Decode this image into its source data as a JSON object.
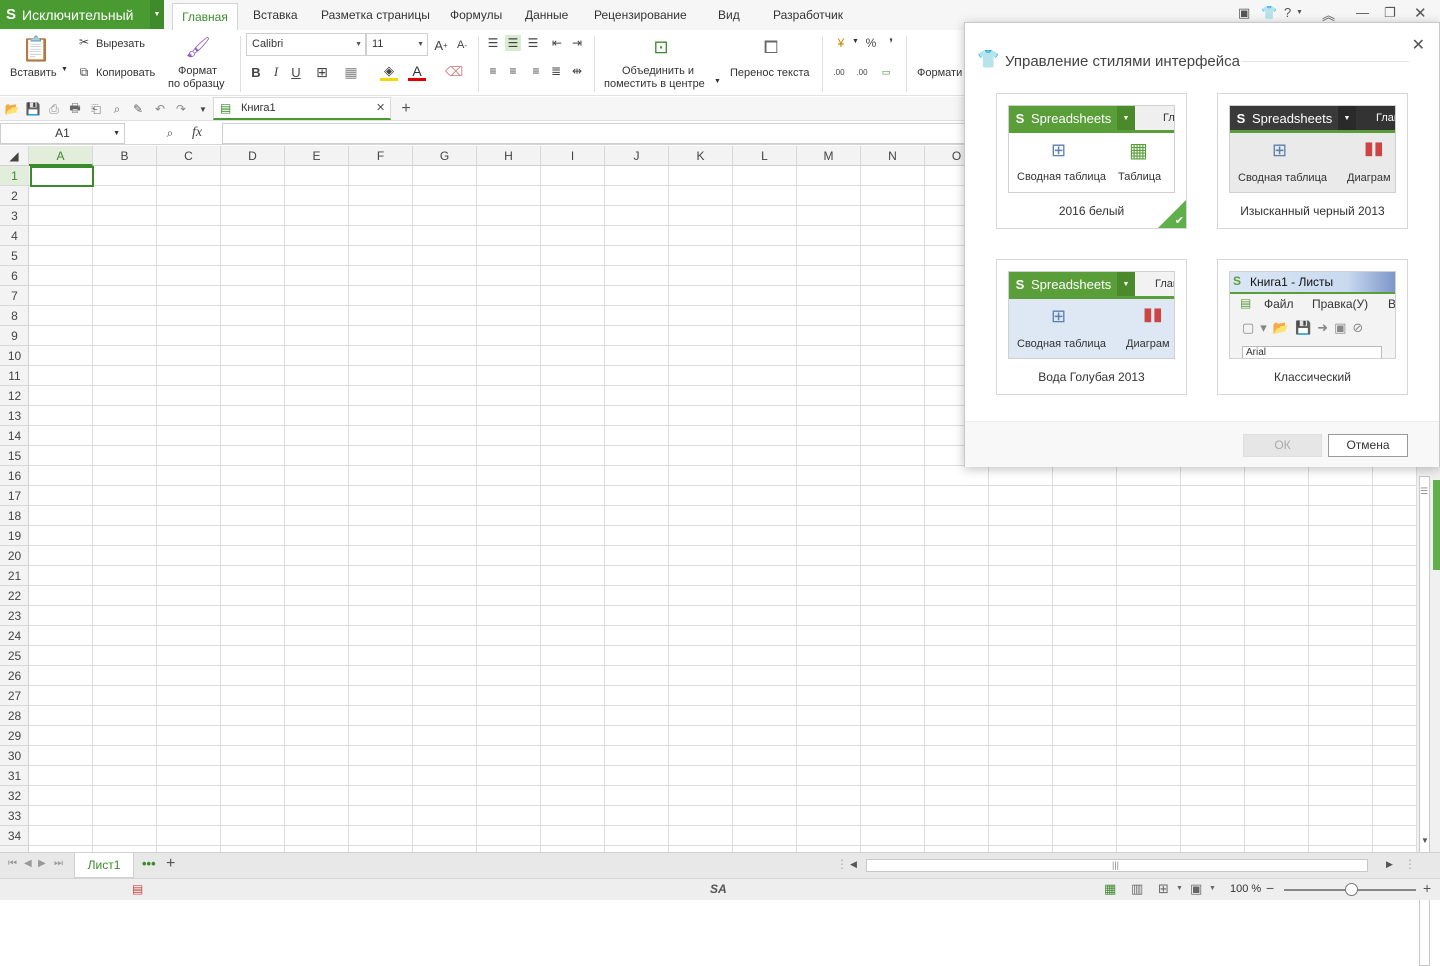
{
  "app": {
    "name": "Исключительный",
    "logo_glyph": "S",
    "accent_color": "#4a9a32"
  },
  "menu_tabs": [
    "Главная",
    "Вставка",
    "Разметка страницы",
    "Формулы",
    "Данные",
    "Рецензирование",
    "Вид",
    "Разработчик"
  ],
  "ribbon": {
    "paste_label": "Вставить",
    "cut_label": "Вырезать",
    "copy_label": "Копировать",
    "format_painter_line1": "Формат",
    "format_painter_line2": "по образцу",
    "font_name": "Calibri",
    "font_size": "11",
    "bold": "B",
    "italic": "I",
    "underline": "U",
    "merge_line1": "Объединить и",
    "merge_line2": "поместить в центре",
    "wrap_label": "Перенос текста",
    "percent": "%",
    "comma": "❜",
    "format_label": "Формати"
  },
  "document_tab": {
    "name": "Книга1"
  },
  "formula_bar": {
    "name_box": "A1",
    "fx": "fx"
  },
  "columns": [
    "A",
    "B",
    "C",
    "D",
    "E",
    "F",
    "G",
    "H",
    "I",
    "J",
    "K",
    "L",
    "M",
    "N",
    "O"
  ],
  "rows": [
    "1",
    "2",
    "3",
    "4",
    "5",
    "6",
    "7",
    "8",
    "9",
    "10",
    "11",
    "12",
    "13",
    "14",
    "15",
    "16",
    "17",
    "18",
    "19",
    "20",
    "21",
    "22",
    "23",
    "24",
    "25",
    "26",
    "27",
    "28",
    "29",
    "30",
    "31",
    "32",
    "33",
    "34"
  ],
  "sheet_tabs": [
    "Лист1"
  ],
  "status": {
    "zoom": "100 %",
    "sa": "SA"
  },
  "dialog": {
    "title": "Управление стилями интерфейса",
    "themes": [
      {
        "name": "2016 белый",
        "bar_label": "Spreadsheets",
        "tab": "Гл",
        "item1": "Сводная таблица",
        "item2": "Таблица",
        "selected": true
      },
      {
        "name": "Изысканный черный 2013",
        "bar_label": "Spreadsheets",
        "tab": "Глав",
        "item1": "Сводная таблица",
        "item2": "Диаграм",
        "selected": false
      },
      {
        "name": "Вода Голубая 2013",
        "bar_label": "Spreadsheets",
        "tab": "Глав",
        "item1": "Сводная таблица",
        "item2": "Диаграм",
        "selected": false
      },
      {
        "name": "Классический",
        "bar_label": "Книга1 - Листы",
        "menu_file": "Файл",
        "menu_edit": "Правка(У)",
        "menu_more": "В",
        "font": "Arial",
        "selected": false
      }
    ],
    "ok_label": "ОК",
    "cancel_label": "Отмена"
  }
}
